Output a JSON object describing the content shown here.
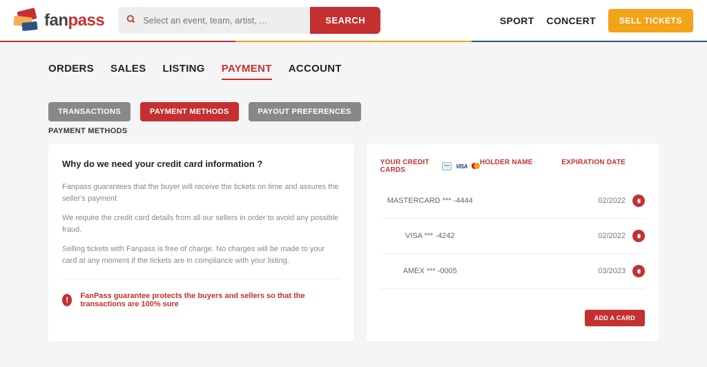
{
  "brand": {
    "name_left": "fan",
    "name_right": "pass"
  },
  "search": {
    "placeholder": "Select an event, team, artist, ...",
    "button": "SEARCH"
  },
  "top_nav": {
    "sport": "SPORT",
    "concert": "CONCERT",
    "sell": "SELL TICKETS"
  },
  "main_tabs": {
    "orders": "ORDERS",
    "sales": "SALES",
    "listing": "LISTING",
    "payment": "PAYMENT",
    "account": "ACCOUNT"
  },
  "sub_tabs": {
    "transactions": "TRANSACTIONS",
    "payment_methods": "PAYMENT METHODS",
    "payout_preferences": "PAYOUT PREFERENCES"
  },
  "section_label": "PAYMENT METHODS",
  "info": {
    "title": "Why do we need your credit card information ?",
    "p1": "Fanpass guarantees that the buyer will receive the tickets on time and assures the seller's payment",
    "p2": "We require the credit card details from all our sellers in order to avoid any possible fraud.",
    "p3": "Selling tickets with Fanpass is free of charge. No charges will be made to your card at any moment if the tickets are in compliance with your listing.",
    "guarantee": "FanPass guarantee protects the buyers and sellers so that the transactions are 100% sure"
  },
  "cards_table": {
    "head_cards": "YOUR CREDIT CARDS",
    "head_holder": "HOLDER NAME",
    "head_exp": "EXPIRATION DATE",
    "rows": [
      {
        "name": "MASTERCARD *** -4444",
        "holder": "",
        "exp": "02/2022"
      },
      {
        "name": "VISA *** -4242",
        "holder": "",
        "exp": "02/2022"
      },
      {
        "name": "AMEX *** -0005",
        "holder": "",
        "exp": "03/2023"
      }
    ],
    "add": "ADD A CARD"
  }
}
